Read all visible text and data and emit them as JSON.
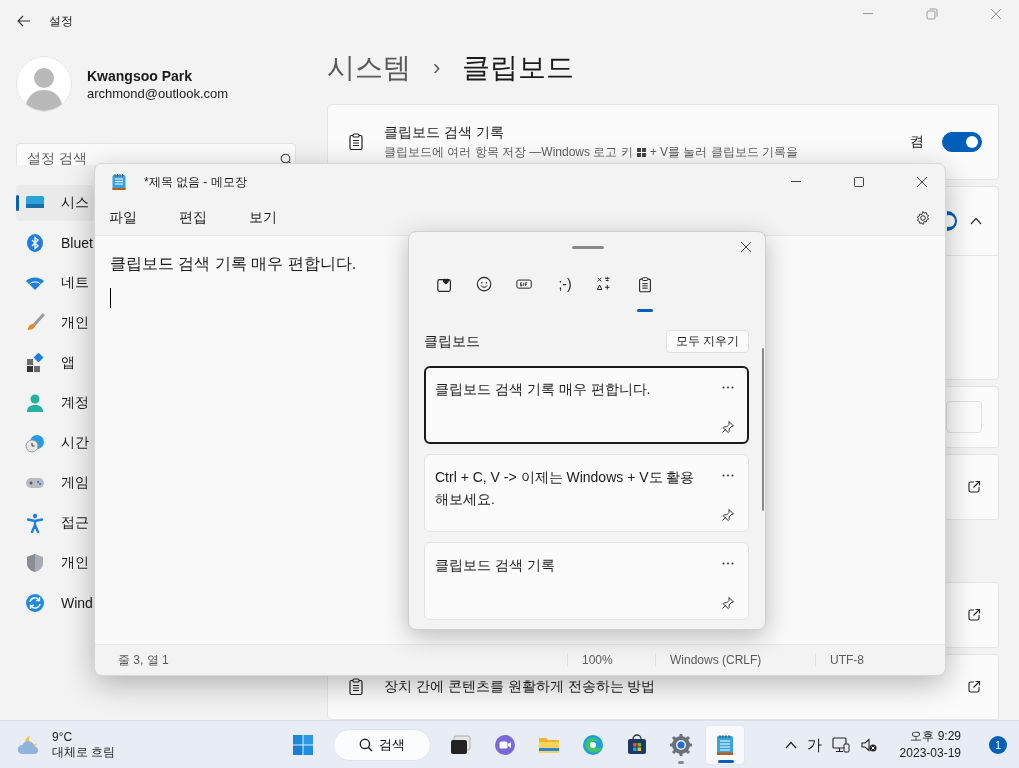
{
  "settings": {
    "title": "설정",
    "user": {
      "name": "Kwangsoo Park",
      "email": "archmond@outlook.com"
    },
    "search": {
      "placeholder": "설정 검색"
    },
    "nav": [
      {
        "label": "시스",
        "selected": true
      },
      {
        "label": "Bluet",
        "selected": false
      },
      {
        "label": "네트",
        "selected": false
      },
      {
        "label": "개인",
        "selected": false
      },
      {
        "label": "앱",
        "selected": false
      },
      {
        "label": "계정",
        "selected": false
      },
      {
        "label": "시간",
        "selected": false
      },
      {
        "label": "게임",
        "selected": false
      },
      {
        "label": "접근",
        "selected": false
      },
      {
        "label": "개인",
        "selected": false
      },
      {
        "label": "Wind",
        "selected": false
      }
    ],
    "breadcrumb": {
      "parent": "시스템",
      "separator": "›",
      "current": "클립보드"
    },
    "cards": [
      {
        "kind": "toggle",
        "title": "클립보드 검색 기록",
        "desc_start": "클립보드에 여러 항목 저장 —Windows 로고 키",
        "desc_end": "+ V를 눌러 클립보드 기록을",
        "state_label": "켬",
        "on": true
      },
      {
        "kind": "expander",
        "on": true,
        "expanded": true
      },
      {
        "kind": "field"
      },
      {
        "kind": "link"
      },
      {
        "kind": "spacer"
      },
      {
        "kind": "link"
      },
      {
        "kind": "link",
        "title": "장치 간에 콘텐츠를 원활하게 전송하는 방법"
      }
    ]
  },
  "notepad": {
    "title": "*제목 없음 - 메모장",
    "menu": [
      "파일",
      "편집",
      "보기"
    ],
    "text": "클립보드 검색 기록 매우 편합니다.",
    "status": [
      "줄 3, 열 1",
      "100%",
      "Windows (CRLF)",
      "UTF-8"
    ]
  },
  "clipboard_panel": {
    "tabs": [
      {
        "kind": "favorites",
        "selected": false
      },
      {
        "kind": "emoji",
        "selected": false
      },
      {
        "kind": "gif",
        "selected": false
      },
      {
        "kind": "kaomoji",
        "label": ";-)",
        "selected": false
      },
      {
        "kind": "symbols",
        "selected": false
      },
      {
        "kind": "clipboard",
        "selected": true
      }
    ],
    "heading": "클립보드",
    "clear_button": "모두 지우기",
    "items": [
      {
        "text": "클립보드 검색 기록 매우 편합니다.",
        "selected": true
      },
      {
        "text": "Ctrl + C, V -> 이제는 Windows + V도 활용 해보세요.",
        "selected": false
      },
      {
        "text": "클립보드 검색 기록",
        "selected": false
      }
    ]
  },
  "taskbar": {
    "weather": {
      "temperature": "9°C",
      "condition": "대체로 흐림"
    },
    "search_label": "검색",
    "apps": [
      {
        "kind": "taskview",
        "running": false,
        "active": false
      },
      {
        "kind": "chat",
        "running": false,
        "active": false
      },
      {
        "kind": "explorer",
        "running": false,
        "active": false
      },
      {
        "kind": "edge",
        "running": false,
        "active": false
      },
      {
        "kind": "store",
        "running": false,
        "active": false
      },
      {
        "kind": "settings",
        "running": true,
        "active": false
      },
      {
        "kind": "notepad",
        "running": true,
        "active": true
      }
    ],
    "ime": "가",
    "time": "오후 9:29",
    "date": "2023-03-19",
    "notification_count": "1"
  }
}
